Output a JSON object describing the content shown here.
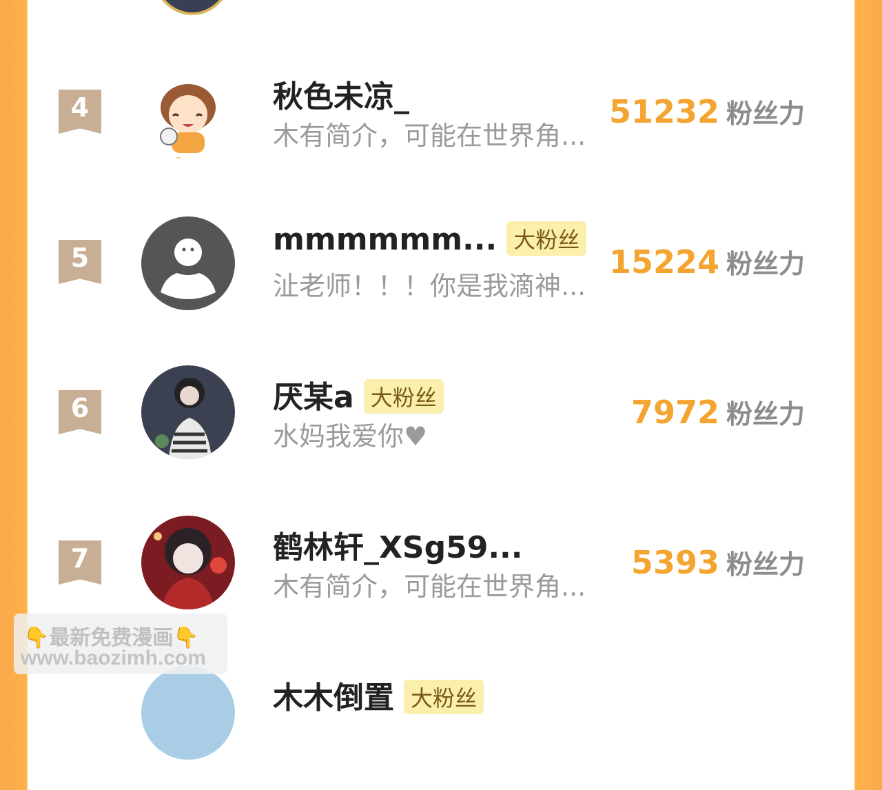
{
  "leaderboard": {
    "score_unit": "粉丝力",
    "rows": [
      {
        "rank": "4",
        "name": "秋色未凉_",
        "badge": "",
        "desc": "木有简介，可能在世界角...",
        "score": "51232"
      },
      {
        "rank": "5",
        "name": "mmmmmm...",
        "badge": "大粉丝",
        "desc": "沚老师！！！你是我滴神...",
        "score": "15224"
      },
      {
        "rank": "6",
        "name": "厌某a",
        "badge": "大粉丝",
        "desc": "水妈我爱你♥",
        "score": "7972"
      },
      {
        "rank": "7",
        "name": "鹤林轩_XSg59...",
        "badge": "",
        "desc": "木有简介，可能在世界角...",
        "score": "5393"
      },
      {
        "rank": "",
        "name": "木木倒置",
        "badge": "大粉丝",
        "desc": "",
        "score": ""
      }
    ]
  },
  "watermark": {
    "line1": "最新免费漫画",
    "line2": "www.baozimh.com",
    "hand_icon": "pointing-down-hand-icon"
  },
  "colors": {
    "accent": "#f4a531",
    "frame": "#ffb24a",
    "rank_badge": "#c8ae95",
    "fan_badge_bg": "#fbefae"
  }
}
